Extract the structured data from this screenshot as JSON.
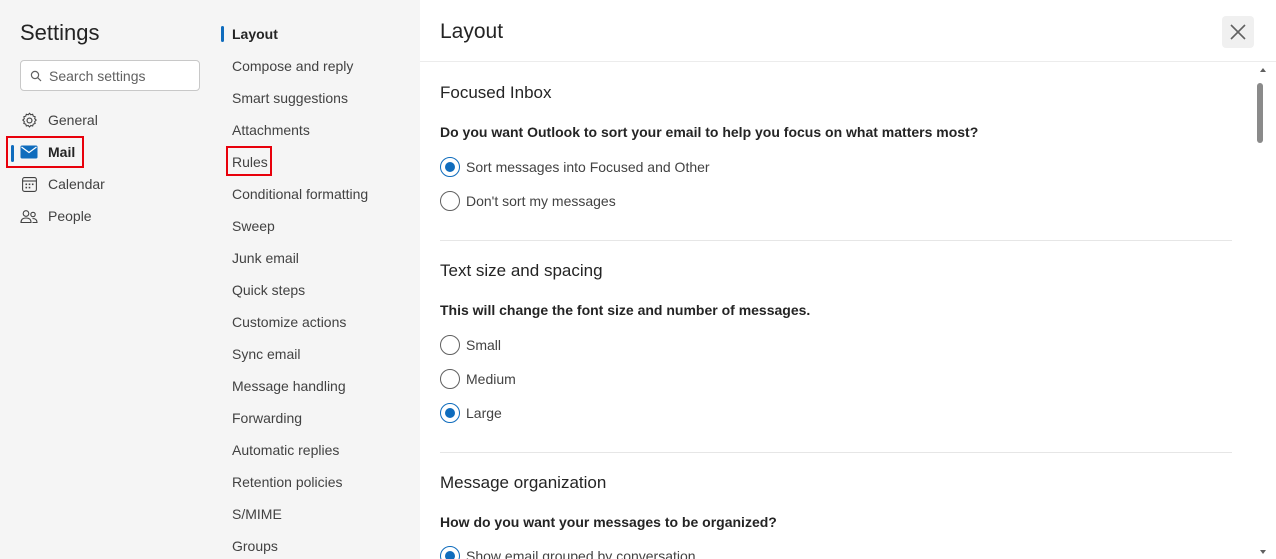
{
  "settings": {
    "title": "Settings",
    "search_placeholder": "Search settings",
    "categories": [
      {
        "label": "General",
        "icon": "gear-icon"
      },
      {
        "label": "Mail",
        "icon": "mail-icon",
        "active": true
      },
      {
        "label": "Calendar",
        "icon": "calendar-icon"
      },
      {
        "label": "People",
        "icon": "people-icon"
      }
    ]
  },
  "mail_menu": [
    {
      "label": "Layout",
      "active": true
    },
    {
      "label": "Compose and reply"
    },
    {
      "label": "Smart suggestions"
    },
    {
      "label": "Attachments"
    },
    {
      "label": "Rules"
    },
    {
      "label": "Conditional formatting"
    },
    {
      "label": "Sweep"
    },
    {
      "label": "Junk email"
    },
    {
      "label": "Quick steps"
    },
    {
      "label": "Customize actions"
    },
    {
      "label": "Sync email"
    },
    {
      "label": "Message handling"
    },
    {
      "label": "Forwarding"
    },
    {
      "label": "Automatic replies"
    },
    {
      "label": "Retention policies"
    },
    {
      "label": "S/MIME"
    },
    {
      "label": "Groups"
    }
  ],
  "main": {
    "title": "Layout",
    "sections": [
      {
        "title": "Focused Inbox",
        "question": "Do you want Outlook to sort your email to help you focus on what matters most?",
        "options": [
          {
            "label": "Sort messages into Focused and Other",
            "checked": true
          },
          {
            "label": "Don't sort my messages",
            "checked": false
          }
        ]
      },
      {
        "title": "Text size and spacing",
        "question": "This will change the font size and number of messages.",
        "options": [
          {
            "label": "Small",
            "checked": false
          },
          {
            "label": "Medium",
            "checked": false
          },
          {
            "label": "Large",
            "checked": true
          }
        ]
      },
      {
        "title": "Message organization",
        "question": "How do you want your messages to be organized?",
        "options": [
          {
            "label": "Show email grouped by conversation",
            "checked": true
          }
        ]
      }
    ]
  },
  "colors": {
    "accent": "#0f6cbd",
    "highlight": "#e8000b"
  }
}
